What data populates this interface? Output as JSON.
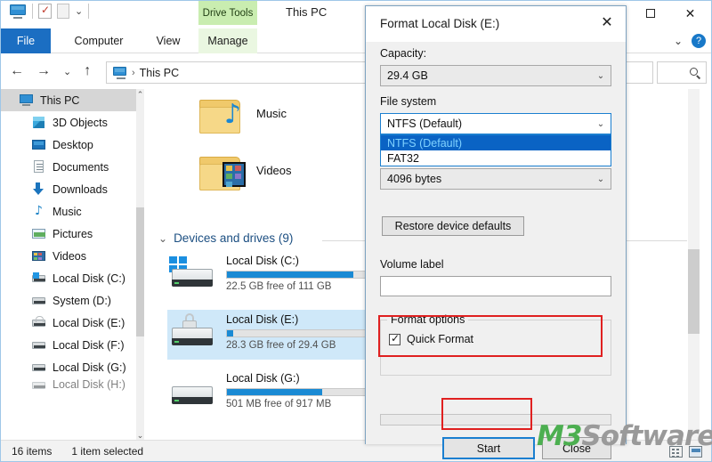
{
  "window": {
    "title": "This PC",
    "contextual_tab": "Drive Tools",
    "quick_access": [
      "this-pc-icon",
      "properties-icon",
      "new-folder-icon",
      "customize-chevron"
    ],
    "controls": {
      "maximize": "▢",
      "close": "✕"
    }
  },
  "ribbon": {
    "tabs": [
      {
        "label": "File"
      },
      {
        "label": "Computer"
      },
      {
        "label": "View"
      },
      {
        "label": "Manage"
      }
    ],
    "collapse_chevron": "⌄",
    "help": "?"
  },
  "address_bar": {
    "back": "←",
    "forward": "→",
    "recent": "⌄",
    "up": "↑",
    "breadcrumb_icon": "this-pc-icon",
    "separator": "›",
    "breadcrumb": "This PC",
    "search_placeholder": "",
    "search_icon": "search-icon"
  },
  "nav_pane": {
    "items": [
      {
        "label": "This PC",
        "icon": "pc-icon",
        "selected": true,
        "indent": false
      },
      {
        "label": "3D Objects",
        "icon": "3d-objects-icon",
        "selected": false,
        "indent": true
      },
      {
        "label": "Desktop",
        "icon": "desktop-icon",
        "selected": false,
        "indent": true
      },
      {
        "label": "Documents",
        "icon": "documents-icon",
        "selected": false,
        "indent": true
      },
      {
        "label": "Downloads",
        "icon": "downloads-icon",
        "selected": false,
        "indent": true
      },
      {
        "label": "Music",
        "icon": "music-icon",
        "selected": false,
        "indent": true
      },
      {
        "label": "Pictures",
        "icon": "pictures-icon",
        "selected": false,
        "indent": true
      },
      {
        "label": "Videos",
        "icon": "videos-icon",
        "selected": false,
        "indent": true
      },
      {
        "label": "Local Disk (C:)",
        "icon": "windows-drive-icon",
        "selected": false,
        "indent": true
      },
      {
        "label": "System (D:)",
        "icon": "drive-icon",
        "selected": false,
        "indent": true
      },
      {
        "label": "Local Disk (E:)",
        "icon": "locked-drive-icon",
        "selected": false,
        "indent": true
      },
      {
        "label": "Local Disk (F:)",
        "icon": "drive-icon",
        "selected": false,
        "indent": true
      },
      {
        "label": "Local Disk (G:)",
        "icon": "drive-icon",
        "selected": false,
        "indent": true
      },
      {
        "label": "Local Disk (H:)",
        "icon": "drive-icon",
        "selected": false,
        "indent": true
      }
    ]
  },
  "content": {
    "folders": [
      {
        "label": "Music",
        "icon": "music-folder-icon"
      },
      {
        "label": "Videos",
        "icon": "videos-folder-icon"
      }
    ],
    "group": {
      "chevron": "⌄",
      "label": "Devices and drives (9)"
    },
    "drives": [
      {
        "name": "Local Disk (C:)",
        "usage_text": "22.5 GB free of 111 GB",
        "used_percent": 80,
        "bar_color": "#1a8ad4",
        "icon": "windows-drive-icon",
        "selected": false
      },
      {
        "name": "Local Disk (E:)",
        "usage_text": "28.3 GB free of 29.4 GB",
        "used_percent": 4,
        "bar_color": "#1a8ad4",
        "icon": "locked-drive-icon",
        "selected": true
      },
      {
        "name": "Local Disk (G:)",
        "usage_text": "501 MB free of 917 MB",
        "used_percent": 60,
        "bar_color": "#1a8ad4",
        "icon": "drive-icon",
        "selected": false
      }
    ],
    "occluded_sizes": [
      "GB",
      "GB"
    ]
  },
  "status_bar": {
    "item_count": "16 items",
    "selection": "1 item selected",
    "view_details_icon": "details-view-icon",
    "view_tiles_icon": "large-icons-view-icon"
  },
  "dialog": {
    "title": "Format Local Disk (E:)",
    "close": "✕",
    "capacity_label": "Capacity:",
    "capacity_value": "29.4 GB",
    "file_system_label": "File system",
    "file_system_value": "NTFS (Default)",
    "file_system_options": [
      {
        "label": "NTFS (Default)",
        "highlighted": true
      },
      {
        "label": "FAT32",
        "highlighted": false
      }
    ],
    "allocation_value": "4096 bytes",
    "restore_defaults_label": "Restore device defaults",
    "volume_label_label": "Volume label",
    "volume_label_value": "",
    "format_options_label": "Format options",
    "quick_format_label": "Quick Format",
    "quick_format_checked": true,
    "start_label": "Start",
    "close_label": "Close",
    "dropdown_arrow": "⌄"
  },
  "watermark": {
    "brand": "M3",
    "product": "Software"
  },
  "colors": {
    "accent_blue": "#1b6ec2",
    "selection_blue": "#0a63c4",
    "highlight_red": "#e02020",
    "contextual_green": "#c9edb0",
    "drive_bar_blue": "#1a8ad4",
    "watermark_green": "#4caf50",
    "watermark_gray": "#9a9a9a"
  }
}
